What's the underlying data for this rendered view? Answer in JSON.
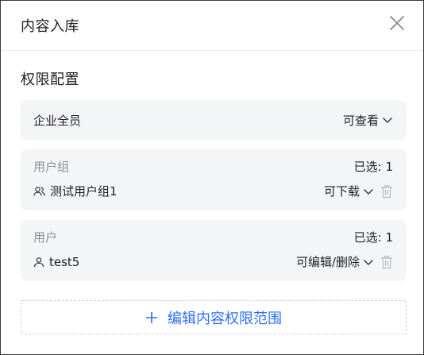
{
  "dialog": {
    "title": "内容入库"
  },
  "permissions": {
    "section_title": "权限配置",
    "all_members": {
      "label": "企业全员",
      "permission": "可查看"
    },
    "user_groups": {
      "label": "用户组",
      "selected_text": "已选: 1",
      "items": [
        {
          "name": "测试用户组1",
          "permission": "可下载"
        }
      ]
    },
    "users": {
      "label": "用户",
      "selected_text": "已选: 1",
      "items": [
        {
          "name": "test5",
          "permission": "可编辑/删除"
        }
      ]
    }
  },
  "footer": {
    "edit_scope_label": "编辑内容权限范围"
  },
  "colors": {
    "accent": "#2d6ff7",
    "card_bg": "#f4f5f7",
    "muted_text": "#8a8e96"
  },
  "icons": {
    "close": "close-icon",
    "chevron": "chevron-down-icon",
    "group": "user-group-icon",
    "user": "user-icon",
    "delete": "trash-icon",
    "add": "plus-icon"
  }
}
